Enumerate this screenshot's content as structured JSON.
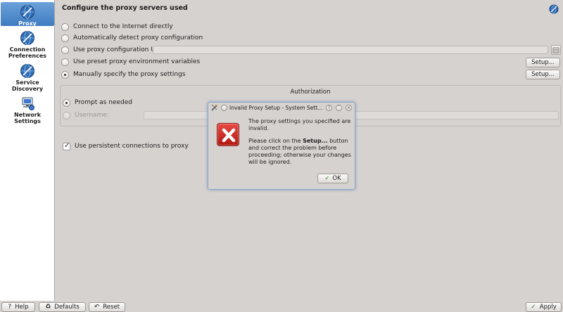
{
  "sidebar": {
    "items": [
      {
        "label": "Proxy",
        "icon": "globe-icon",
        "selected": true
      },
      {
        "label": "Connection Preferences",
        "icon": "globe-icon",
        "selected": false
      },
      {
        "label": "Service Discovery",
        "icon": "globe-icon",
        "selected": false
      },
      {
        "label": "Network Settings",
        "icon": "network-computer-icon",
        "selected": false
      }
    ]
  },
  "main": {
    "title": "Configure the proxy servers used",
    "options": {
      "direct": "Connect to the Internet directly",
      "auto": "Automatically detect proxy configuration",
      "url": "Use proxy configuration URL:",
      "env": "Use preset proxy environment variables",
      "manual": "Manually specify the proxy settings"
    },
    "env_setup_label": "Setup...",
    "manual_setup_label": "Setup...",
    "authorization": {
      "title": "Authorization",
      "prompt_label": "Prompt as needed",
      "username_label": "Username:"
    },
    "persistent_label": "Use persistent connections to proxy"
  },
  "bottom": {
    "help_label": "Help",
    "defaults_label": "Defaults",
    "reset_label": "Reset",
    "apply_label": "Apply"
  },
  "dialog": {
    "title": "Invalid Proxy Setup - System Sett...",
    "message_line1": "The proxy settings you specified are invalid.",
    "message_p2_before": "Please click on the ",
    "message_p2_bold": "Setup...",
    "message_p2_after": " button and correct the problem before proceeding; otherwise your changes will be ignored.",
    "ok_label": "OK"
  },
  "colors": {
    "selection": "#4a87c9",
    "error_red": "#d1342c",
    "window_bg": "#d6d2d0"
  }
}
